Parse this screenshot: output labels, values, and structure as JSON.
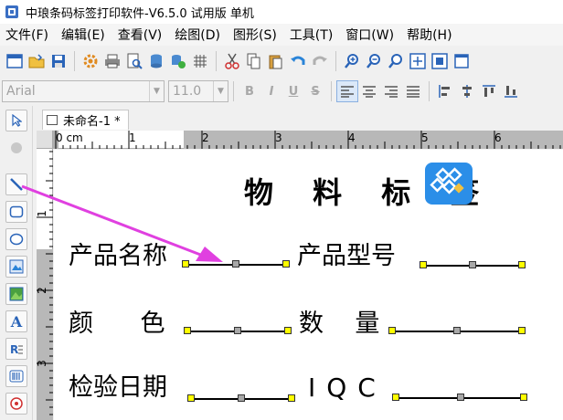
{
  "window": {
    "title": "中琅条码标签打印软件-V6.5.0 试用版 单机"
  },
  "menu": [
    "文件(F)",
    "编辑(E)",
    "查看(V)",
    "绘图(D)",
    "图形(S)",
    "工具(T)",
    "窗口(W)",
    "帮助(H)"
  ],
  "font_toolbar": {
    "font_name": "Arial",
    "font_size": "11.0",
    "bold": "B",
    "italic": "I",
    "underline": "U",
    "strike": "S"
  },
  "document": {
    "tab_title": "未命名-1 *"
  },
  "ruler": {
    "h_labels": [
      "0 cm",
      "1",
      "2",
      "3",
      "4",
      "5",
      "6"
    ],
    "v_labels": [
      "1",
      "2",
      "3"
    ]
  },
  "label": {
    "heading": "物 料 标 签",
    "fields": [
      {
        "name": "产品名称"
      },
      {
        "name": "产品型号"
      },
      {
        "name": "颜      色"
      },
      {
        "name": "数    量"
      },
      {
        "name": "检验日期"
      },
      {
        "name": "IQC"
      }
    ]
  },
  "colors": {
    "accent_arrow": "#e040e0",
    "handle_yellow": "#ffff00",
    "logo_blue": "#2b8ee8"
  }
}
